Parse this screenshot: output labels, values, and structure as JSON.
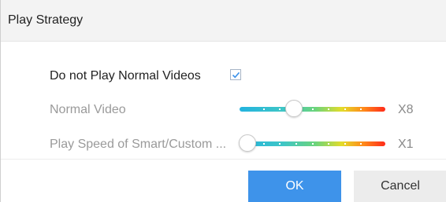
{
  "dialog": {
    "title": "Play Strategy"
  },
  "options": {
    "do_not_play_label": "Do not Play Normal Videos",
    "do_not_play_checked": true,
    "normal_video": {
      "label": "Normal Video",
      "speed": "X8",
      "level": 0.36
    },
    "smart_custom": {
      "label": "Play Speed of Smart/Custom ...",
      "speed": "X1",
      "level": 0.0
    }
  },
  "buttons": {
    "ok": "OK",
    "cancel": "Cancel"
  },
  "colors": {
    "ok_button": "#3e93ea",
    "slider_start": "#23b3df",
    "slider_end": "#ff2a1a"
  }
}
